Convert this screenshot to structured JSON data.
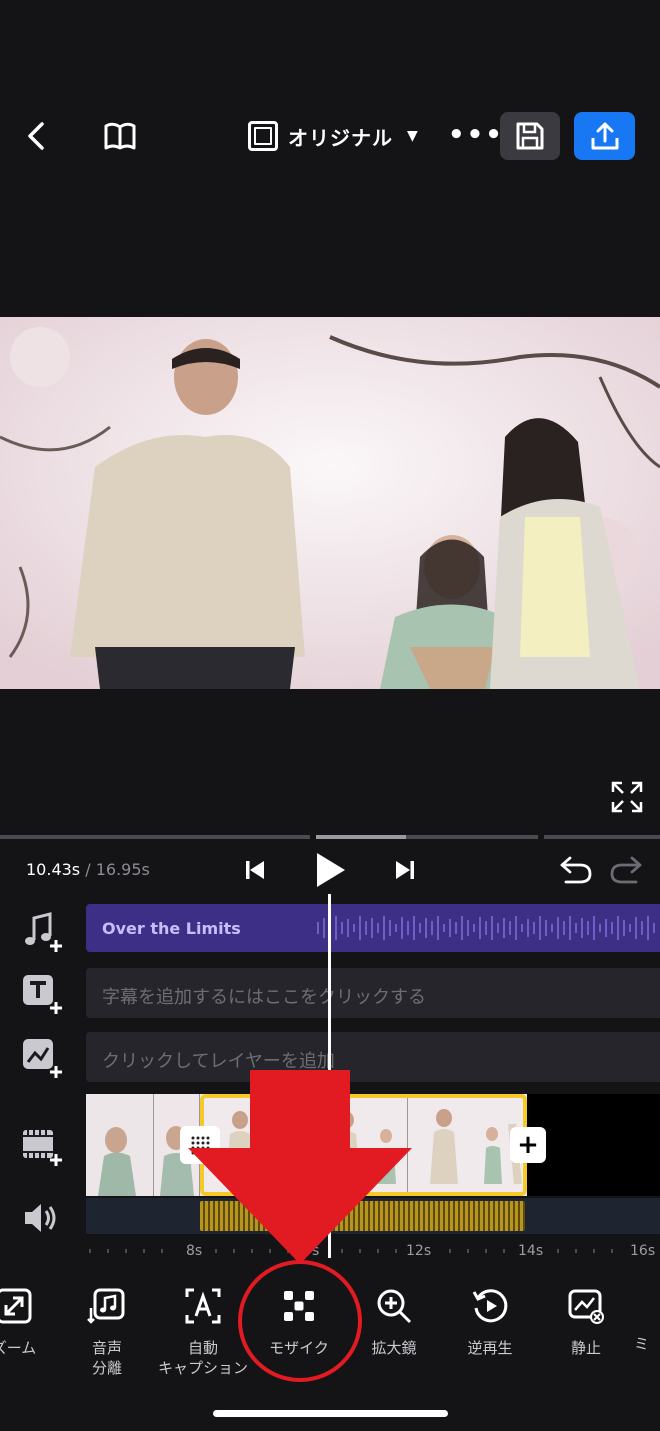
{
  "topbar": {
    "ratio_label": "オリジナル"
  },
  "transport": {
    "current_time": "10.43s",
    "separator": " / ",
    "duration": "16.95s"
  },
  "tracks": {
    "music_title": "Over the Limits",
    "caption_hint": "字幕を追加するにはここをクリックする",
    "layer_hint": "クリックしてレイヤーを追加"
  },
  "ruler": {
    "labels": [
      "8s",
      "s",
      "12s",
      "14s",
      "16s"
    ]
  },
  "toolbar": {
    "items": [
      {
        "label": "ズーム",
        "icon": "zoom-expand-icon"
      },
      {
        "label": "音声\n分離",
        "icon": "audio-separate-icon"
      },
      {
        "label": "自動\nキャプション",
        "icon": "auto-caption-icon"
      },
      {
        "label": "モザイク",
        "icon": "mosaic-icon"
      },
      {
        "label": "拡大鏡",
        "icon": "magnifier-icon"
      },
      {
        "label": "逆再生",
        "icon": "reverse-play-icon"
      },
      {
        "label": "静止",
        "icon": "freeze-frame-icon"
      },
      {
        "label": "ミ",
        "icon": "mix-icon"
      }
    ]
  },
  "colors": {
    "accent_blue": "#1877f2",
    "music_track": "#3d2f86",
    "selection": "#f6c928",
    "annotation_red": "#e21b23"
  }
}
